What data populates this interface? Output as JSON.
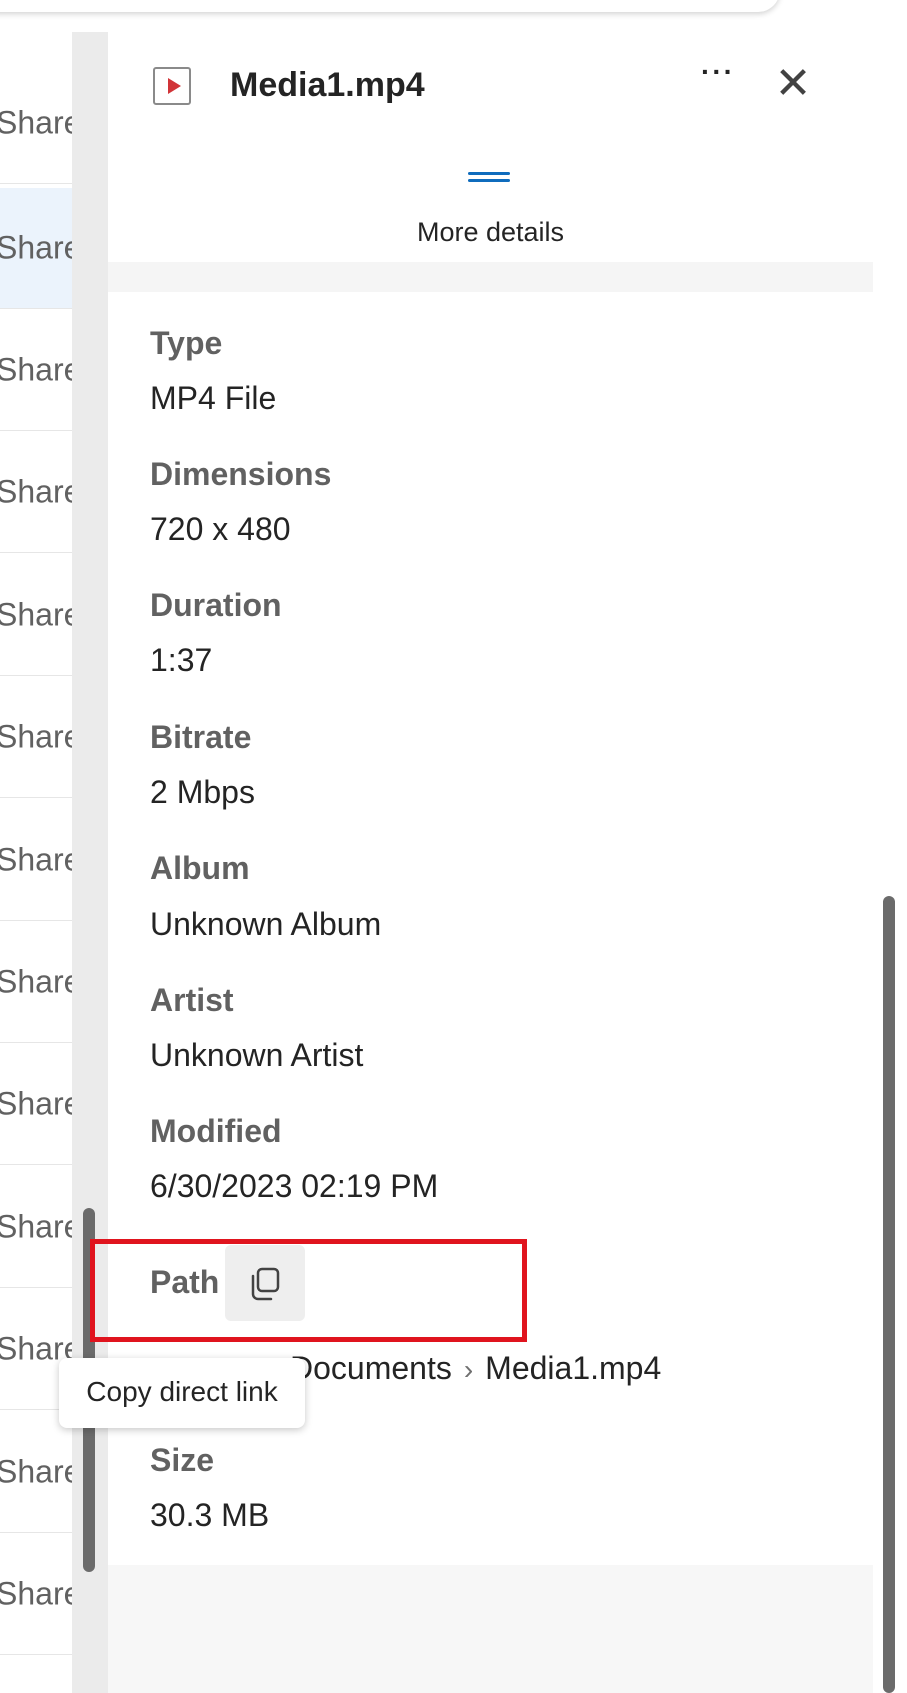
{
  "list": {
    "row_label": "Share",
    "rows": [
      "Share",
      "Share",
      "Share",
      "Share",
      "Share",
      "Share",
      "Share",
      "Share",
      "Share",
      "Share",
      "Share",
      "Share",
      "Share"
    ]
  },
  "header": {
    "title": "Media1.mp4",
    "more_label": "···",
    "close_label": "✕",
    "more_details": "More details"
  },
  "properties": [
    {
      "label": "Type",
      "value": "MP4 File"
    },
    {
      "label": "Dimensions",
      "value": "720 x 480"
    },
    {
      "label": "Duration",
      "value": "1:37"
    },
    {
      "label": "Bitrate",
      "value": "2 Mbps"
    },
    {
      "label": "Album",
      "value": "Unknown Album"
    },
    {
      "label": "Artist",
      "value": "Unknown Artist"
    },
    {
      "label": "Modified",
      "value": "6/30/2023 02:19 PM"
    }
  ],
  "path": {
    "label": "Path",
    "crumbs": [
      "Documents",
      "Media1.mp4"
    ],
    "separator": "›"
  },
  "size": {
    "label": "Size",
    "value": "30.3 MB"
  },
  "tooltip": "Copy direct link",
  "colors": {
    "accent": "#0f6cbd",
    "highlight": "#e0141e",
    "video_icon": "#d13438"
  }
}
